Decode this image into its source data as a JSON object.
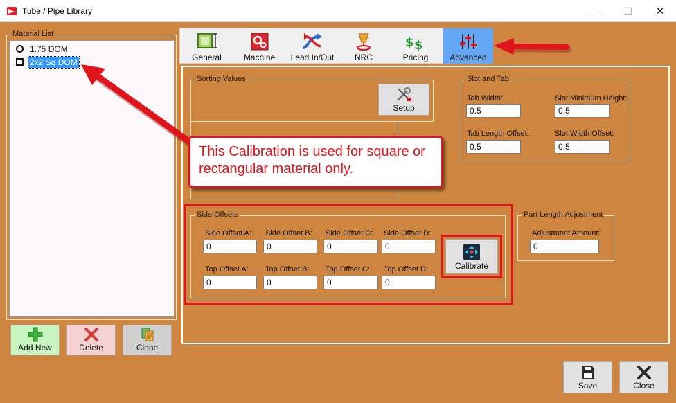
{
  "window": {
    "title": "Tube / Pipe Library",
    "minimize_glyph": "—",
    "maximize_glyph": "☐",
    "close_glyph": "✕"
  },
  "material_list": {
    "legend": "Material List",
    "items": [
      {
        "label": "1.75 DOM",
        "icon": "circle-icon",
        "selected": false
      },
      {
        "label": "2x2 Sq DOM",
        "icon": "square-icon",
        "selected": true
      }
    ]
  },
  "list_buttons": {
    "add_new": "Add New",
    "delete": "Delete",
    "clone": "Clone"
  },
  "tabs": [
    {
      "label": "General",
      "icon": "general-icon",
      "active": false
    },
    {
      "label": "Machine",
      "icon": "machine-icon",
      "active": false
    },
    {
      "label": "Lead In/Out",
      "icon": "lead-in-out-icon",
      "active": false
    },
    {
      "label": "NRC",
      "icon": "nrc-icon",
      "active": false
    },
    {
      "label": "Pricing",
      "icon": "pricing-icon",
      "active": false
    },
    {
      "label": "Advanced",
      "icon": "advanced-sliders-icon",
      "active": true
    }
  ],
  "sorting_values": {
    "legend": "Sorting Values",
    "setup_label": "Setup"
  },
  "slot_and_tab": {
    "legend": "Slot and Tab",
    "tab_width_label": "Tab Width:",
    "tab_width_value": "0.5",
    "slot_min_height_label": "Slot Minimum Height:",
    "slot_min_height_value": "0.5",
    "tab_length_offset_label": "Tab Length Offset:",
    "tab_length_offset_value": "0.5",
    "slot_width_offset_label": "Slot Width Offset:",
    "slot_width_offset_value": "0.5"
  },
  "side_offsets": {
    "legend": "Side Offsets",
    "side_labels": [
      "Side Offset A:",
      "Side Offset B:",
      "Side Offset C:",
      "Side Offset D:"
    ],
    "side_values": [
      "0",
      "0",
      "0",
      "0"
    ],
    "top_labels": [
      "Top Offset A:",
      "Top Offset B:",
      "Top Offset C:",
      "Top Offset D:"
    ],
    "top_values": [
      "0",
      "0",
      "0",
      "0"
    ],
    "calibrate_label": "Calibrate"
  },
  "part_length": {
    "legend": "Part Length Adjustment",
    "amount_label": "Adjustment Amount:",
    "amount_value": "0"
  },
  "footer": {
    "save": "Save",
    "close": "Close"
  },
  "callout": {
    "text": "This Calibration is used for square or rectangular material only."
  },
  "colors": {
    "background": "#cd853f",
    "active_tab": "#63a7f5",
    "selection": "#3399ff",
    "annotation_red": "#e0141b"
  }
}
